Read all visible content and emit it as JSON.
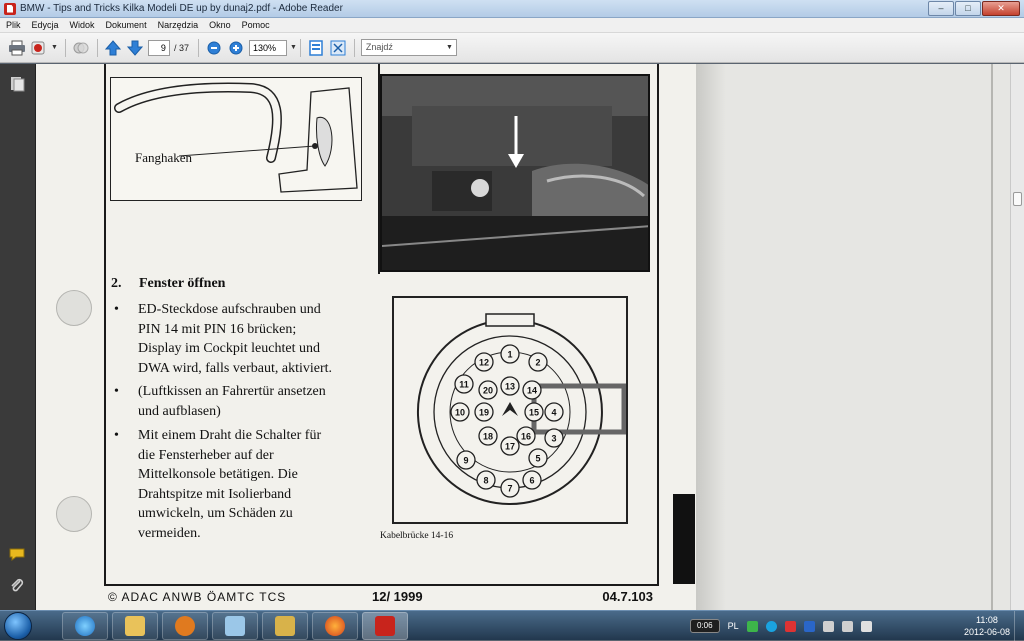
{
  "window": {
    "title": "BMW - Tips and Tricks Kilka Modeli DE up by dunaj2.pdf - Adobe Reader",
    "controls": {
      "minimize": "–",
      "maximize": "□",
      "close": "✕"
    }
  },
  "menu": {
    "items": [
      "Plik",
      "Edycja",
      "Widok",
      "Dokument",
      "Narzędzia",
      "Okno",
      "Pomoc"
    ]
  },
  "toolbar": {
    "page_current": "9",
    "page_total": "/ 37",
    "zoom": "130%",
    "search_placeholder": "Znajdź"
  },
  "document": {
    "hook_label": "Fanghaken",
    "section_number": "2.",
    "section_title": "Fenster öffnen",
    "bullets": [
      [
        "ED-Steckdose aufschrauben und",
        "PIN 14 mit PIN 16 brücken;",
        "Display im Cockpit leuchtet und",
        "DWA wird, falls verbaut, aktiviert."
      ],
      [
        "(Luftkissen an Fahrertür ansetzen",
        "und aufblasen)"
      ],
      [
        "Mit einem Draht die Schalter für",
        "die Fensterheber auf der",
        "Mittelkonsole betätigen. Die",
        "Drahtspitze mit Isolierband",
        "umwickeln, um Schäden zu",
        "vermeiden."
      ]
    ],
    "bullet_symbol": "•",
    "connector_caption": "Kabelbrücke 14-16",
    "pins": [
      "1",
      "2",
      "3",
      "4",
      "5",
      "6",
      "7",
      "8",
      "9",
      "10",
      "11",
      "12",
      "13",
      "14",
      "15",
      "16",
      "17",
      "18",
      "19",
      "20"
    ],
    "footer_left": "© ADAC ANWB ÖAMTC TCS",
    "footer_mid": "12/ 1999",
    "footer_right": "04.7.103"
  },
  "taskbar": {
    "language": "PL",
    "badge": "0:06",
    "time": "11:08",
    "date": "2012-06-08"
  },
  "colors": {
    "taskbar_top": "#4a6b8a",
    "paper": "#f2f1ec",
    "highlight_box": "#6b6b6b"
  }
}
